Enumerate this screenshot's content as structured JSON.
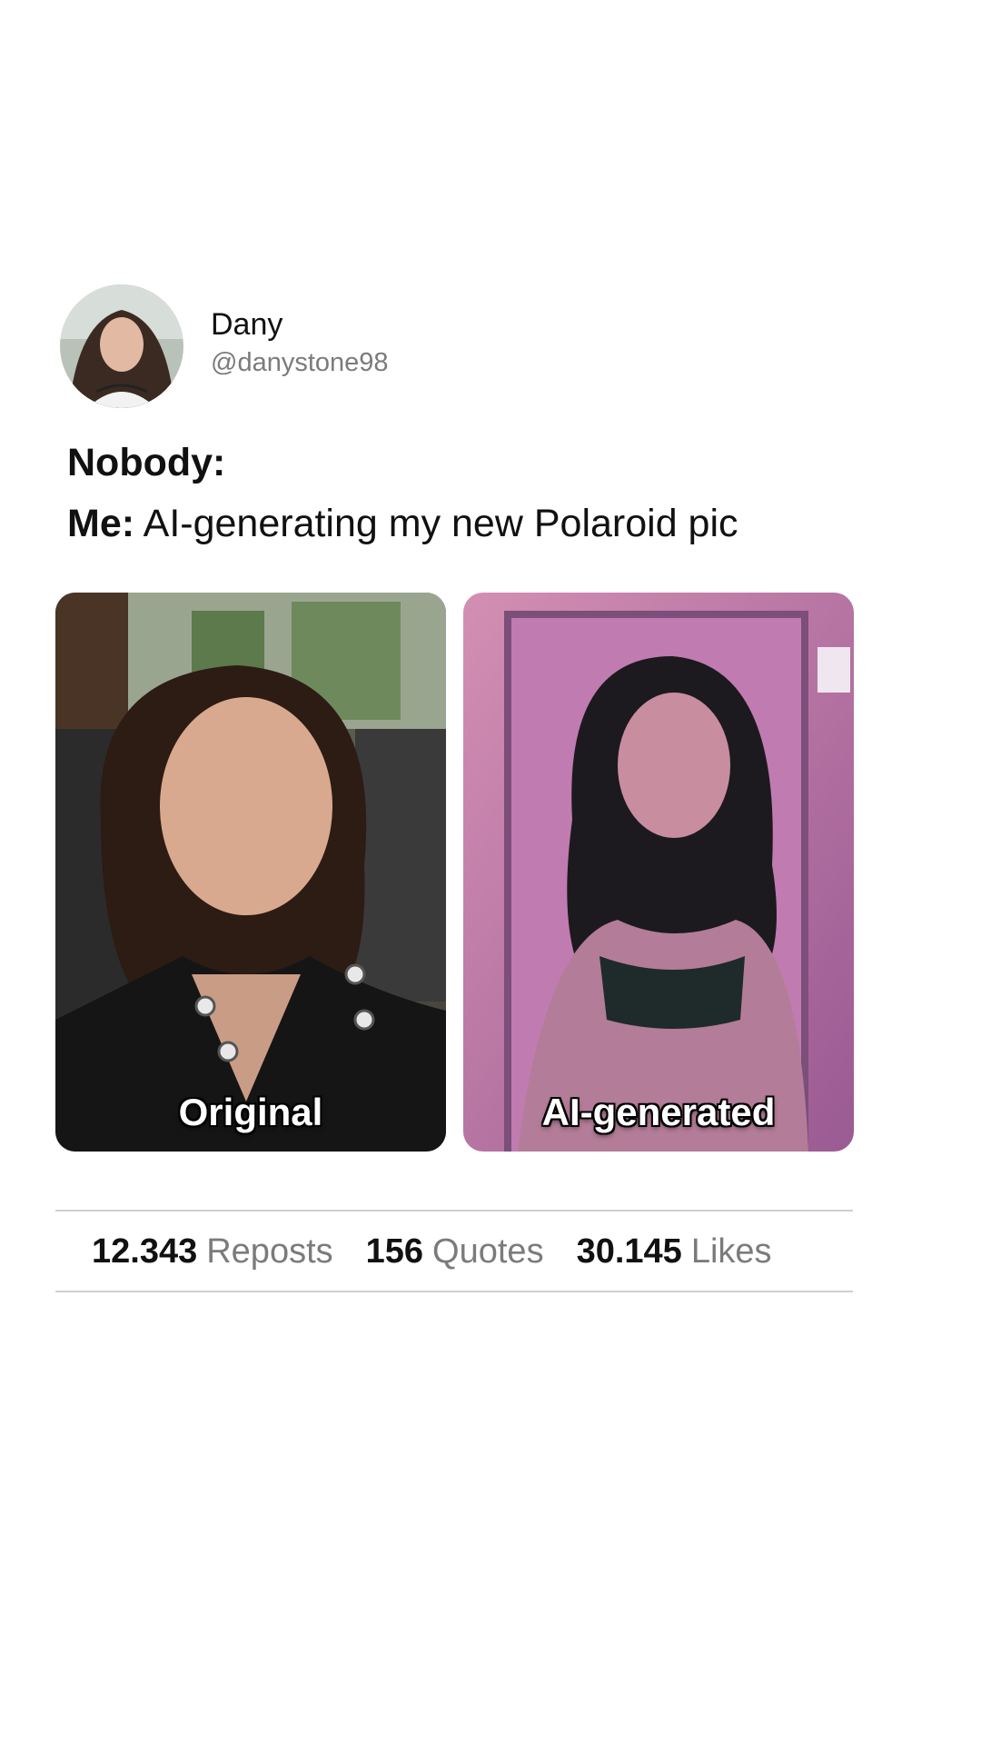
{
  "author": {
    "name": "Dany",
    "handle": "@danystone98"
  },
  "post": {
    "line1": "Nobody:",
    "line2_lead": "Me:",
    "line2_text": "AI-generating my new Polaroid pic"
  },
  "photos": [
    {
      "caption": "Original"
    },
    {
      "caption": "AI-generated"
    }
  ],
  "stats": [
    {
      "value": "12.343",
      "label": "Reposts"
    },
    {
      "value": "156",
      "label": "Quotes"
    },
    {
      "value": "30.145",
      "label": "Likes"
    }
  ],
  "colors": {
    "text_primary": "#111111",
    "text_secondary": "#7b7b7b",
    "divider": "#cfcfcf",
    "background": "#ffffff"
  }
}
